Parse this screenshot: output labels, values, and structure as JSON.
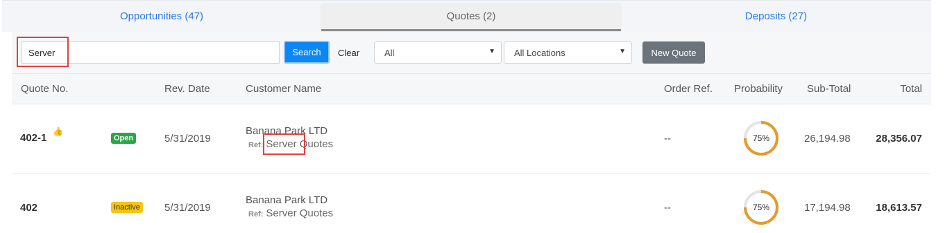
{
  "tabs": [
    {
      "label": "Opportunities (47)"
    },
    {
      "label": "Quotes (2)"
    },
    {
      "label": "Deposits (27)"
    }
  ],
  "toolbar": {
    "search_value": "Server",
    "search_label": "Search",
    "clear_label": "Clear",
    "status_select": "All",
    "location_select": "All Locations",
    "new_quote_label": "New Quote"
  },
  "table": {
    "headers": [
      "Quote No.",
      "Rev. Date",
      "Customer Name",
      "Order Ref.",
      "Probability",
      "Sub-Total",
      "Total"
    ],
    "rows": [
      {
        "quote_no": "402-1",
        "status": "Open",
        "rev_date": "5/31/2019",
        "customer": "Banana Park LTD",
        "ref_label": "Ref:",
        "ref_highlight": "Server",
        "ref_rest": "Quotes",
        "order_ref": "--",
        "probability": "75%",
        "probability_value": 0.75,
        "sub_total": "26,194.98",
        "total": "28,356.07"
      },
      {
        "quote_no": "402",
        "status": "Inactive",
        "rev_date": "5/31/2019",
        "customer": "Banana Park LTD",
        "ref_label": "Ref:",
        "ref_highlight": "Server",
        "ref_rest": "Quotes",
        "order_ref": "--",
        "probability": "75%",
        "probability_value": 0.75,
        "sub_total": "17,194.98",
        "total": "18,613.57"
      }
    ]
  },
  "colors": {
    "accent": "#2a7ae2",
    "search_button": "#0d87f5",
    "highlight_box": "#e0403e",
    "progress": "#e59a2c",
    "progress_track": "#e4e4e4",
    "open_badge": "#28a745",
    "inactive_badge": "#f5c518"
  },
  "icons": {
    "thumb": "thumbs-up-icon",
    "caret": "caret-down-icon"
  }
}
